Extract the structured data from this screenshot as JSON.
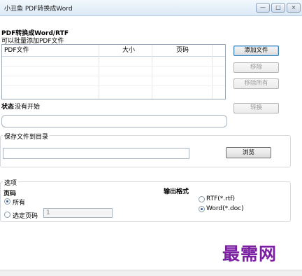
{
  "window": {
    "title": "小丑鱼 PDF转换成Word",
    "controls": {
      "minimize": "—",
      "maximize": "□",
      "close": "×"
    }
  },
  "header": {
    "title": "PDF转换成Word/RTF",
    "subtitle": "可以批量添加PDF文件"
  },
  "file_table": {
    "columns": [
      "PDF文件",
      "大小",
      "页码"
    ],
    "rows": []
  },
  "buttons": {
    "add_file": "添加文件",
    "remove": "移除",
    "remove_all": "移除所有",
    "convert": "转换",
    "browse": "浏览"
  },
  "status": {
    "label": "状态",
    "value": "没有开始"
  },
  "save_dir": {
    "group_label": "保存文件到目录",
    "value": ""
  },
  "options": {
    "group_label": "选项",
    "pages_label": "页码",
    "all_label": "所有",
    "selected_pages_label": "选定页码",
    "selected_pages_value": "1",
    "all_selected": true,
    "output_format_label": "输出格式",
    "rtf_label": "RTF(*.rtf)",
    "word_label": "Word(*.doc)",
    "word_selected": true
  },
  "watermark": {
    "text": "最需网"
  },
  "colors": {
    "watermark": "#7b1fa2",
    "title_bar": "#dbe9f6"
  }
}
